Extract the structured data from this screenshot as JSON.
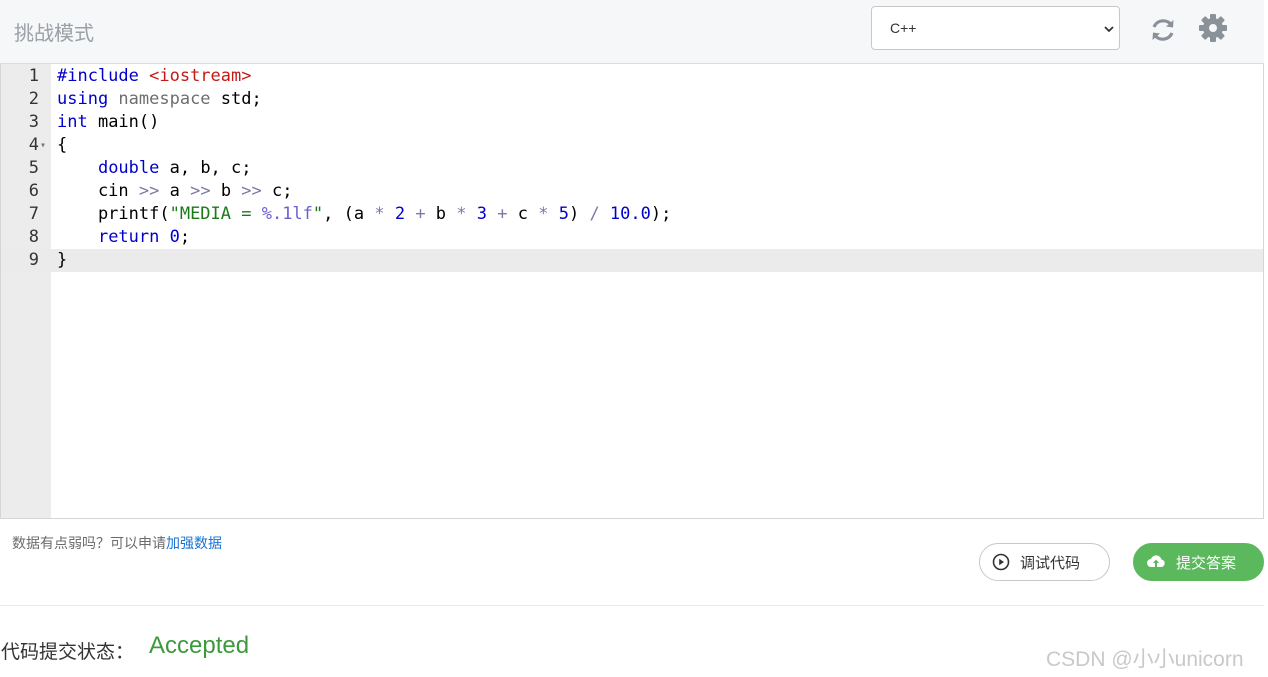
{
  "header": {
    "title": "挑战模式",
    "language": "C++",
    "icons": [
      "refresh-icon",
      "gear-icon"
    ]
  },
  "editor": {
    "lines": [
      {
        "n": "1",
        "tokens": [
          [
            "pp",
            "#include "
          ],
          [
            "inc",
            "<iostream>"
          ]
        ]
      },
      {
        "n": "2",
        "tokens": [
          [
            "kw",
            "using "
          ],
          [
            "ns",
            "namespace "
          ],
          [
            "plain",
            "std;"
          ]
        ]
      },
      {
        "n": "3",
        "tokens": [
          [
            "kw",
            "int "
          ],
          [
            "plain",
            "main()"
          ]
        ]
      },
      {
        "n": "4",
        "tokens": [
          [
            "plain",
            "{"
          ]
        ],
        "fold": true
      },
      {
        "n": "5",
        "tokens": [
          [
            "plain",
            "    "
          ],
          [
            "kw",
            "double "
          ],
          [
            "plain",
            "a, b, c;"
          ]
        ]
      },
      {
        "n": "6",
        "tokens": [
          [
            "plain",
            "    cin "
          ],
          [
            "op",
            ">> "
          ],
          [
            "plain",
            "a "
          ],
          [
            "op",
            ">> "
          ],
          [
            "plain",
            "b "
          ],
          [
            "op",
            ">> "
          ],
          [
            "plain",
            "c;"
          ]
        ]
      },
      {
        "n": "7",
        "tokens": [
          [
            "plain",
            "    printf("
          ],
          [
            "str",
            "\"MEDIA = "
          ],
          [
            "fmt",
            "%.1lf"
          ],
          [
            "str",
            "\""
          ],
          [
            "plain",
            ", (a "
          ],
          [
            "op",
            "* "
          ],
          [
            "num",
            "2 "
          ],
          [
            "op",
            "+ "
          ],
          [
            "plain",
            "b "
          ],
          [
            "op",
            "* "
          ],
          [
            "num",
            "3 "
          ],
          [
            "op",
            "+ "
          ],
          [
            "plain",
            "c "
          ],
          [
            "op",
            "* "
          ],
          [
            "num",
            "5"
          ],
          [
            "plain",
            ") "
          ],
          [
            "op",
            "/ "
          ],
          [
            "num",
            "10.0"
          ],
          [
            "plain",
            ");"
          ]
        ]
      },
      {
        "n": "8",
        "tokens": [
          [
            "plain",
            "    "
          ],
          [
            "kw",
            "return "
          ],
          [
            "num",
            "0"
          ],
          [
            "plain",
            ";"
          ]
        ]
      },
      {
        "n": "9",
        "tokens": [
          [
            "plain",
            "}"
          ]
        ],
        "active": true
      }
    ]
  },
  "hint": {
    "text": "数据有点弱吗？可以申请",
    "link": "加强数据"
  },
  "buttons": {
    "debug": "调试代码",
    "submit": "提交答案"
  },
  "status": {
    "label": "代码提交状态：",
    "value": "Accepted",
    "value_color": "#3c9a3c"
  },
  "watermark": "CSDN @小小unicorn",
  "colors": {
    "accent_green": "#5cb85c",
    "link_blue": "#1c73d4"
  }
}
